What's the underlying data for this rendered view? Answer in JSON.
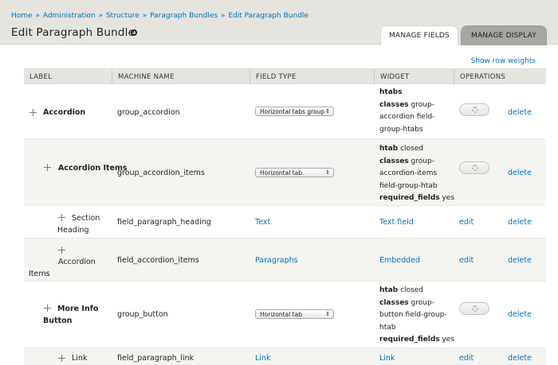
{
  "breadcrumb": {
    "items": [
      "Home",
      "Administration",
      "Structure",
      "Paragraph Bundles",
      "Edit Paragraph Bundle"
    ],
    "separator": "»"
  },
  "page": {
    "title": "Edit Paragraph Bundle"
  },
  "tabs": {
    "manage_fields": "MANAGE FIELDS",
    "manage_display": "MANAGE DISPLAY"
  },
  "show_row_weights": "Show row weights",
  "table": {
    "headers": {
      "label": "LABEL",
      "machine_name": "MACHINE NAME",
      "field_type": "FIELD TYPE",
      "widget": "WIDGET",
      "operations": "OPERATIONS"
    },
    "rows": [
      {
        "label": "Accordion",
        "machine_name": "group_accordion",
        "field_type": "Horizontal tabs group",
        "widget_lines": [
          {
            "k": "htabs",
            "v": ""
          },
          {
            "k": "classes",
            "v": " group-"
          },
          {
            "k": "",
            "v": "accordion field-"
          },
          {
            "k": "",
            "v": "group-htabs"
          }
        ],
        "delete": "delete"
      },
      {
        "label": "Accordion Items",
        "machine_name": "group_accordion_items",
        "field_type": "Horizontal tab",
        "widget_lines": [
          {
            "k": "htab",
            "v": " closed"
          },
          {
            "k": "classes",
            "v": " group-"
          },
          {
            "k": "",
            "v": "accordion-items"
          },
          {
            "k": "",
            "v": "field-group-htab"
          },
          {
            "k": "required_fields",
            "v": " yes"
          }
        ],
        "delete": "delete"
      },
      {
        "label": "Section Heading",
        "machine_name": "field_paragraph_heading",
        "field_type": "Text",
        "widget": "Text field",
        "edit": "edit",
        "delete": "delete"
      },
      {
        "label": "Accordion Items",
        "machine_name": "field_accordion_items",
        "field_type": "Paragraphs",
        "widget": "Embedded",
        "edit": "edit",
        "delete": "delete"
      },
      {
        "label": "More Info Button",
        "machine_name": "group_button",
        "field_type": "Horizontal tab",
        "widget_lines": [
          {
            "k": "htab",
            "v": " closed"
          },
          {
            "k": "classes",
            "v": " group-"
          },
          {
            "k": "",
            "v": "button field-group-"
          },
          {
            "k": "",
            "v": "htab"
          },
          {
            "k": "required_fields",
            "v": " yes"
          }
        ],
        "delete": "delete"
      },
      {
        "label": "Link",
        "machine_name": "field_paragraph_link",
        "field_type": "Link",
        "widget": "Link",
        "edit": "edit",
        "delete": "delete"
      }
    ]
  },
  "colors": {
    "link": "#0074bd",
    "header_bg": "#e5e4df",
    "row_alt": "#f4f4f0",
    "tab_inactive": "#a6a6a3"
  },
  "icons": {
    "drag_handle": "drag-handle-icon",
    "settings": "gear-icon",
    "select_arrow": "chevron-updown-icon"
  }
}
